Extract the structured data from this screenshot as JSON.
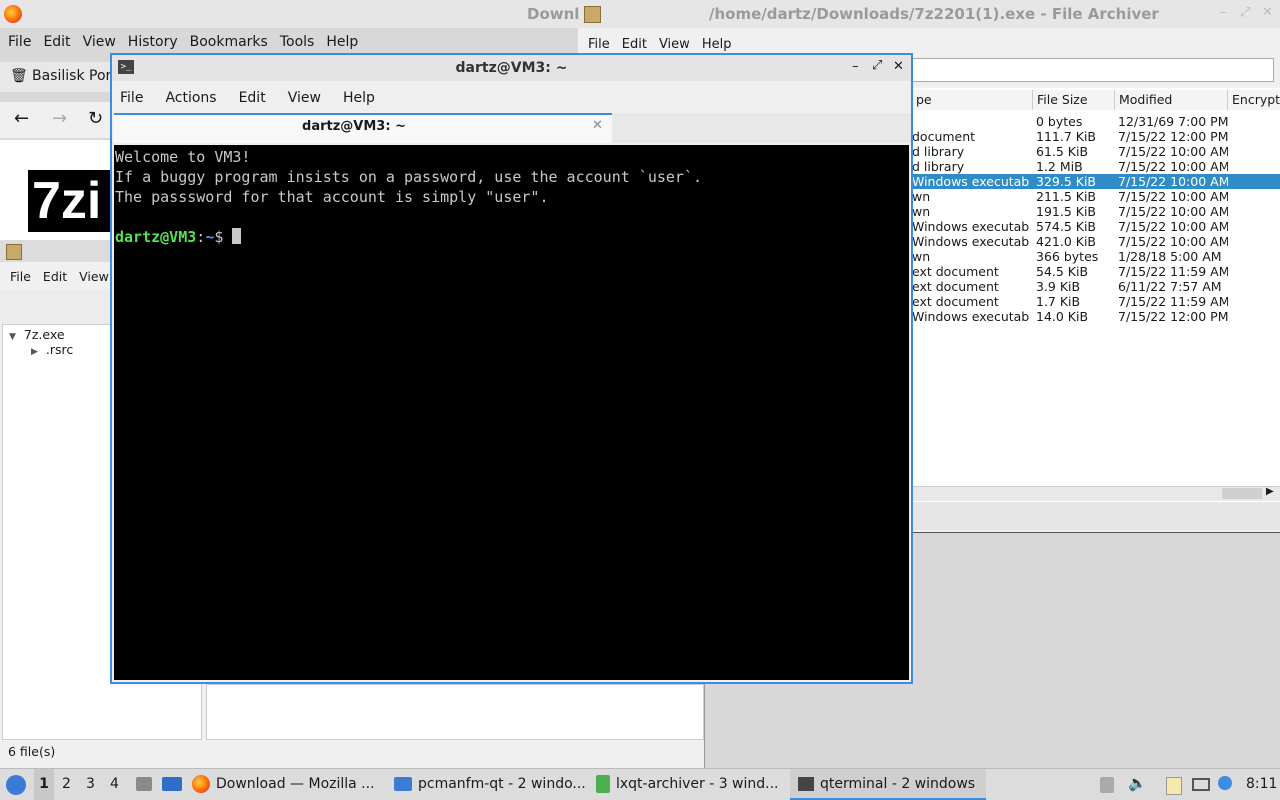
{
  "browser": {
    "window_title": "Downl",
    "menu": [
      "File",
      "Edit",
      "View",
      "History",
      "Bookmarks",
      "Tools",
      "Help"
    ],
    "tab_label": "Basilisk Port",
    "logo_text": "7zi"
  },
  "archiver": {
    "window_title": "/home/dartz/Downloads/7z2201(1).exe - File Archiver",
    "menu": [
      "File",
      "Edit",
      "View",
      "Help"
    ],
    "columns": [
      "pe",
      "File Size",
      "Modified",
      "Encrypt"
    ],
    "rows": [
      {
        "type": "",
        "size": "0 bytes",
        "modified": "12/31/69 7:00 PM"
      },
      {
        "type": "document",
        "size": "111.7 KiB",
        "modified": "7/15/22 12:00 PM"
      },
      {
        "type": "d library",
        "size": "61.5 KiB",
        "modified": "7/15/22 10:00 AM"
      },
      {
        "type": "d library",
        "size": "1.2 MiB",
        "modified": "7/15/22 10:00 AM"
      },
      {
        "type": "Windows executable",
        "size": "329.5 KiB",
        "modified": "7/15/22 10:00 AM"
      },
      {
        "type": "wn",
        "size": "211.5 KiB",
        "modified": "7/15/22 10:00 AM"
      },
      {
        "type": "wn",
        "size": "191.5 KiB",
        "modified": "7/15/22 10:00 AM"
      },
      {
        "type": "Windows executable",
        "size": "574.5 KiB",
        "modified": "7/15/22 10:00 AM"
      },
      {
        "type": "Windows executable",
        "size": "421.0 KiB",
        "modified": "7/15/22 10:00 AM"
      },
      {
        "type": "wn",
        "size": "366 bytes",
        "modified": "1/28/18 5:00 AM"
      },
      {
        "type": "ext document",
        "size": "54.5 KiB",
        "modified": "7/15/22 11:59 AM"
      },
      {
        "type": "ext document",
        "size": "3.9 KiB",
        "modified": "6/11/22 7:57 AM"
      },
      {
        "type": "ext document",
        "size": "1.7 KiB",
        "modified": "7/15/22 11:59 AM"
      },
      {
        "type": "Windows executable",
        "size": "14.0 KiB",
        "modified": "7/15/22 12:00 PM"
      }
    ],
    "selected_row": 4
  },
  "pcmanfm": {
    "menu": [
      "File",
      "Edit",
      "View"
    ],
    "tree": [
      "7z.exe",
      ".rsrc"
    ],
    "status": "6 file(s)"
  },
  "terminal": {
    "window_title": "dartz@VM3: ~",
    "tab_title": "dartz@VM3: ~",
    "menu": [
      "File",
      "Actions",
      "Edit",
      "View",
      "Help"
    ],
    "lines": [
      "Welcome to VM3!",
      "If a buggy program insists on a password, use the account `user`.",
      "The passsword for that account is simply \"user\"."
    ],
    "prompt_user": "dartz@VM3",
    "prompt_sep": ":",
    "prompt_path": "~",
    "prompt_end": "$"
  },
  "taskbar": {
    "workspaces": [
      "1",
      "2",
      "3",
      "4"
    ],
    "tasks": [
      "Download — Mozilla ...",
      "pcmanfm-qt - 2 windo...",
      "lxqt-archiver - 3 wind...",
      "qterminal - 2 windows"
    ],
    "clock": "8:11"
  },
  "colors": {
    "accent": "#3c8de0",
    "selection": "#308cc6",
    "prompt_green": "#54e354",
    "prompt_blue": "#5f87ff"
  }
}
